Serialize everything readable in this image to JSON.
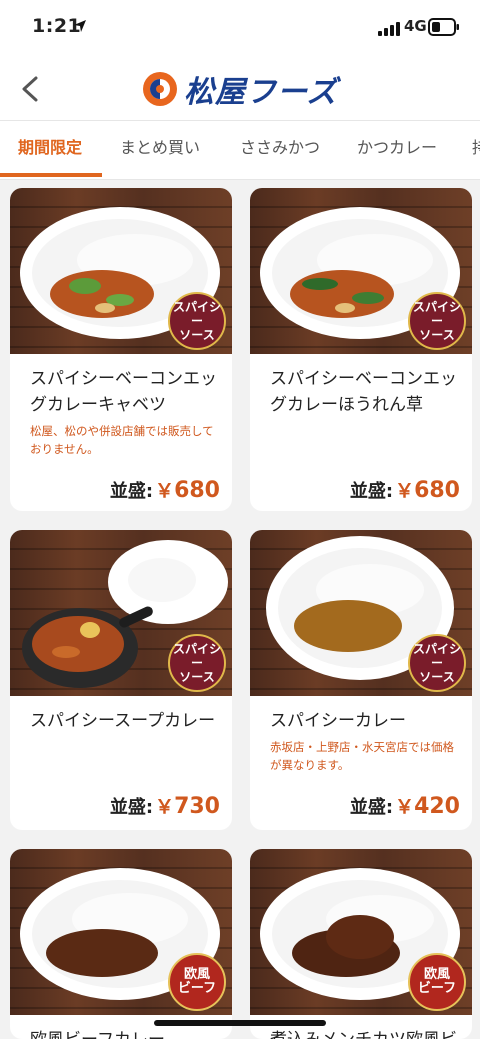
{
  "status": {
    "time": "1:21",
    "network": "4G"
  },
  "header": {
    "brand": "松屋フーズ"
  },
  "tabs": [
    {
      "label": "期間限定",
      "active": true
    },
    {
      "label": "まとめ買い"
    },
    {
      "label": "ささみかつ"
    },
    {
      "label": "かつカレー"
    },
    {
      "label": "持"
    }
  ],
  "items": [
    {
      "name": "スパイシーベーコンエッグカレーキャベツ",
      "note": "松屋、松のや併設店舗では販売しておりません。",
      "price_label": "並盛:",
      "currency": "￥",
      "price": "680",
      "badge": [
        "スパイシー",
        "ソース"
      ]
    },
    {
      "name": "スパイシーベーコンエッグカレーほうれん草",
      "note": "",
      "price_label": "並盛:",
      "currency": "￥",
      "price": "680",
      "badge": [
        "スパイシー",
        "ソース"
      ]
    },
    {
      "name": "スパイシースープカレー",
      "note": "",
      "price_label": "並盛:",
      "currency": "￥",
      "price": "730",
      "badge": [
        "スパイシー",
        "ソース"
      ]
    },
    {
      "name": "スパイシーカレー",
      "note": "赤坂店・上野店・水天宮店では価格が異なります。",
      "price_label": "並盛:",
      "currency": "￥",
      "price": "420",
      "badge": [
        "スパイシー",
        "ソース"
      ]
    },
    {
      "name": "欧風ビーフカレー",
      "note": "",
      "price_label": "",
      "currency": "",
      "price": "",
      "badge": [
        "欧風",
        "ビーフ"
      ]
    },
    {
      "name": "煮込みメンチカツ欧風ビ",
      "note": "",
      "price_label": "",
      "currency": "",
      "price": "",
      "badge": [
        "欧風",
        "ビーフ"
      ]
    }
  ]
}
